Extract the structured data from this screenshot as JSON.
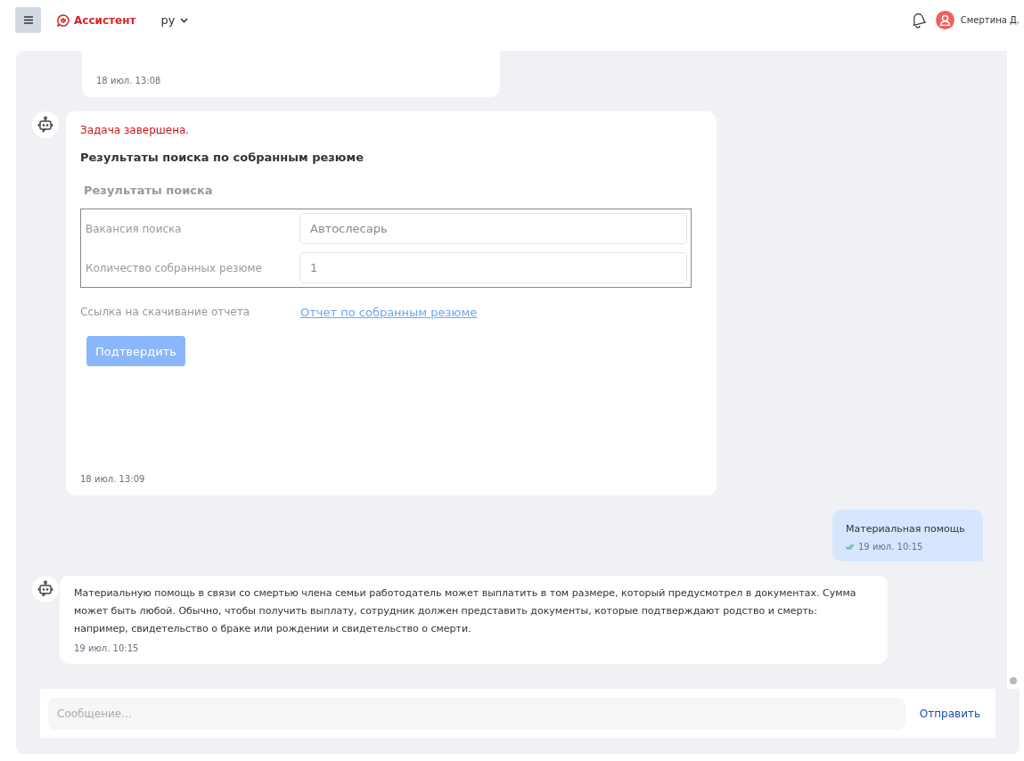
{
  "header": {
    "brand": "Ассистент",
    "language": "ру",
    "user_name": "Смертина Д."
  },
  "messages": [
    {
      "kind": "partial",
      "time": "18 июл. 13:08"
    },
    {
      "kind": "task",
      "status": "Задача завершена.",
      "title": "Результаты поиска по собранным резюме",
      "section": "Результаты поиска",
      "fields": [
        {
          "label": "Вакансия поиска",
          "value": "Автослесарь"
        },
        {
          "label": "Количество собранных резюме",
          "value": "1"
        }
      ],
      "link_label": "Ссылка на скачивание отчета",
      "link_text": "Отчет по собранным резюме",
      "button": "Подтвердить",
      "time": "18 июл. 13:09"
    },
    {
      "kind": "user",
      "text": "Материальная помощь",
      "delivered": true,
      "time": "19 июл. 10:15"
    },
    {
      "kind": "bot",
      "text": "Материальную помощь в связи со смертью члена семьи работодатель может выплатить в том размере, который предусмотрел в документах. Сумма может быть любой. Обычно, чтобы получить выплату, сотрудник должен представить документы, которые подтверждают родство и смерть: например, свидетельство о браке или рождении и свидетельство о смерти.",
      "time": "19 июл. 10:15"
    }
  ],
  "composer": {
    "placeholder": "Сообщение...",
    "send": "Отправить"
  }
}
